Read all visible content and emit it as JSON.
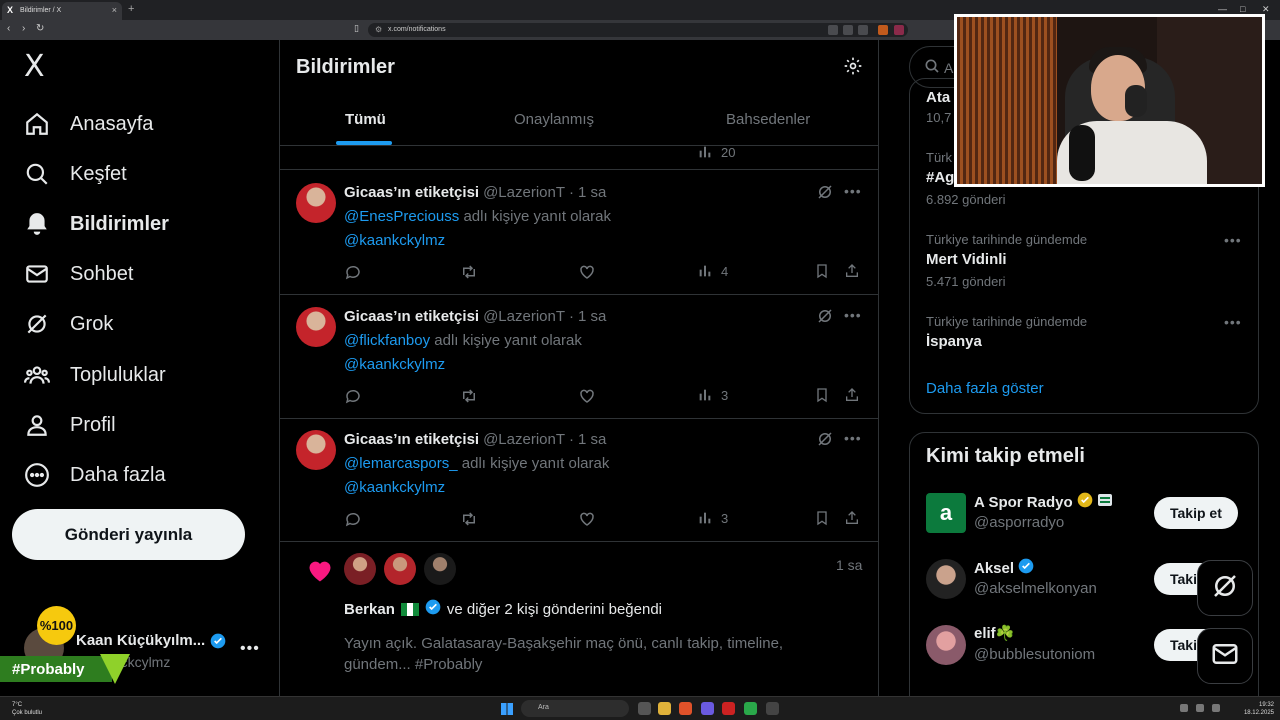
{
  "browser": {
    "tab_title": "Bildirimler / X",
    "tab_favicon": "X",
    "url": "x.com/notifications"
  },
  "nav": {
    "logo": "X",
    "items": [
      {
        "label": "Anasayfa",
        "icon": "home-icon"
      },
      {
        "label": "Keşfet",
        "icon": "search-icon"
      },
      {
        "label": "Bildirimler",
        "icon": "bell-icon",
        "active": true
      },
      {
        "label": "Sohbet",
        "icon": "mail-icon"
      },
      {
        "label": "Grok",
        "icon": "grok-icon"
      },
      {
        "label": "Topluluklar",
        "icon": "communities-icon"
      },
      {
        "label": "Profil",
        "icon": "person-icon"
      },
      {
        "label": "Daha fazla",
        "icon": "more-circle-icon"
      }
    ],
    "post_button": "Gönderi yayınla",
    "account": {
      "name": "Kaan Küçükyılm...",
      "handle": "@kaanckcylmz"
    }
  },
  "overlay": {
    "badge": "%100",
    "hashtag": "#Probably"
  },
  "main": {
    "title": "Bildirimler",
    "tabs": [
      "Tümü",
      "Onaylanmış",
      "Bahsedenler"
    ],
    "active_tab": 0,
    "partial_view_count": "20",
    "notifications": [
      {
        "name": "Gicaas’ın etiketçisi",
        "handle": "@LazerionT",
        "time": "1 sa",
        "reply_to": "@EnesPreciouss",
        "reply_suffix": "adlı kişiye yanıt olarak",
        "mention": "@kaankckylmz",
        "views": "4"
      },
      {
        "name": "Gicaas’ın etiketçisi",
        "handle": "@LazerionT",
        "time": "1 sa",
        "reply_to": "@flickfanboy",
        "reply_suffix": "adlı kişiye yanıt olarak",
        "mention": "@kaankckylmz",
        "views": "3"
      },
      {
        "name": "Gicaas’ın etiketçisi",
        "handle": "@LazerionT",
        "time": "1 sa",
        "reply_to": "@lemarcaspors_",
        "reply_suffix": "adlı kişiye yanıt olarak",
        "mention": "@kaankckylmz",
        "views": "3"
      }
    ],
    "like_notification": {
      "time": "1 sa",
      "actor": "Berkan",
      "text": "ve diğer 2 kişi gönderini beğendi",
      "preview": "Yayın açık. Galatasaray-Başakşehir maç önü, canlı takip, timeline, gündem... #Probably"
    }
  },
  "sidebar": {
    "search_placeholder": "A",
    "trends": [
      {
        "context": "",
        "name": "Ata",
        "count": "10,7"
      },
      {
        "context": "Türk",
        "name": "#Ag",
        "count": "6.892 gönderi"
      },
      {
        "context": "Türkiye tarihinde gündemde",
        "name": "Mert Vidinli",
        "count": "5.471 gönderi"
      },
      {
        "context": "Türkiye tarihinde gündemde",
        "name": "İspanya",
        "count": ""
      }
    ],
    "show_more": "Daha fazla göster",
    "who_to_follow": {
      "title": "Kimi takip etmeli",
      "accounts": [
        {
          "name": "A Spor Radyo",
          "handle": "@asporradyo",
          "button": "Takip et",
          "avatar_letter": "a"
        },
        {
          "name": "Aksel",
          "handle": "@akselmelkonyan",
          "button": "Takip et"
        },
        {
          "name": "elif☘️",
          "handle": "@bubblesutoniom",
          "button": "Takip et"
        }
      ]
    }
  },
  "taskbar": {
    "weather_temp": "7°C",
    "weather_desc": "Çok bulutlu",
    "search": "Ara",
    "time": "19:32",
    "date": "18.12.2025"
  },
  "colors": {
    "accent": "#1d9bf0",
    "background": "#000000",
    "border": "#2f3336",
    "like": "#f91880",
    "verified": "#1d9bf0",
    "gold_verified": "#e2b719"
  }
}
